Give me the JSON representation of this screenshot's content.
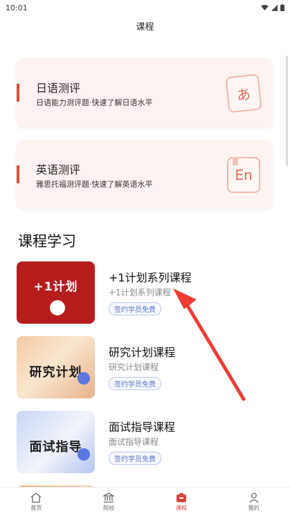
{
  "status_bar": {
    "time": "10:01"
  },
  "nav": {
    "title": "课程"
  },
  "eval_cards": [
    {
      "title": "日语测评",
      "desc": "日语能力测评题·快速了解日语水平",
      "emblem": "あ"
    },
    {
      "title": "英语测评",
      "desc": "雅思托福测评题·快速了解英语水平",
      "emblem": "En"
    }
  ],
  "section": {
    "title": "课程学习"
  },
  "courses": [
    {
      "title": "+1计划系列课程",
      "subtitle": "+1计划系列课程",
      "badge": "签约学员免费",
      "thumb_text": "+1计划"
    },
    {
      "title": "研究计划课程",
      "subtitle": "研究计划课程",
      "badge": "签约学员免费",
      "thumb_text": "研究计划"
    },
    {
      "title": "面试指导课程",
      "subtitle": "面试指导课程",
      "badge": "签约学员免费",
      "thumb_text": "面试指导"
    }
  ],
  "tabs": [
    {
      "label": "首页",
      "icon": "home-icon"
    },
    {
      "label": "院校",
      "icon": "school-icon"
    },
    {
      "label": "课程",
      "icon": "course-icon",
      "active": true
    },
    {
      "label": "我的",
      "icon": "person-icon"
    }
  ],
  "colors": {
    "accent": "#e24f3b",
    "tab_active": "#d8443a",
    "badge": "#5b73c9"
  }
}
